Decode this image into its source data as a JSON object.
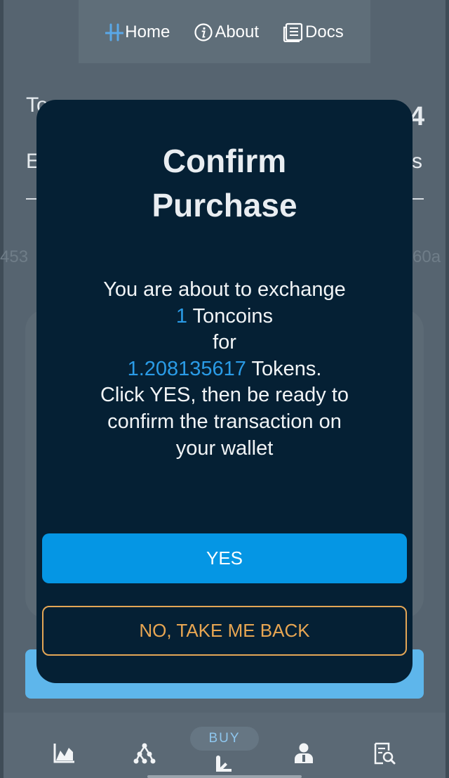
{
  "nav": {
    "home": "Home",
    "about": "About",
    "docs": "Docs"
  },
  "background": {
    "token_price_fragment": "To",
    "price_fragment": "4",
    "row2_left_fragment": "E",
    "row2_right_fragment": "s",
    "hash_left_fragment": "453",
    "hash_right_fragment": "60a"
  },
  "modal": {
    "title_line1": "Confirm",
    "title_line2": "Purchase",
    "message_line1": "You are about to exchange",
    "ton_amount": "1",
    "ton_unit": " Toncoins",
    "for_word": "for",
    "token_amount": "1.208135617",
    "token_unit": " Tokens.",
    "message_line5": "Click YES, then be ready to",
    "message_line6": "confirm the transaction on",
    "message_line7": "your wallet",
    "yes_label": "YES",
    "no_label": "NO, TAKE ME BACK"
  },
  "bottom_nav": {
    "buy_label": "BUY",
    "items": [
      "chart-icon",
      "network-icon",
      "buy-hand-icon",
      "profile-icon",
      "search-report-icon"
    ]
  },
  "colors": {
    "accent_blue": "#2a9be6",
    "yes_button": "#0596e4",
    "no_button": "#e4a656",
    "modal_bg": "#052034"
  }
}
